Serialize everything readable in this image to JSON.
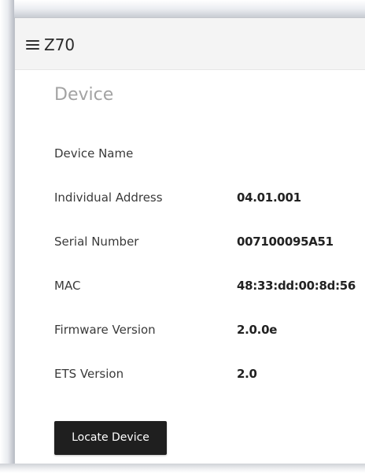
{
  "header": {
    "menu_icon": "hamburger-menu-icon",
    "title": "Z70"
  },
  "section": {
    "title": "Device"
  },
  "device_info": {
    "rows": [
      {
        "label": "Device Name",
        "value": ""
      },
      {
        "label": "Individual Address",
        "value": "04.01.001"
      },
      {
        "label": "Serial Number",
        "value": "007100095A51"
      },
      {
        "label": "MAC",
        "value": "48:33:dd:00:8d:56"
      },
      {
        "label": "Firmware Version",
        "value": "2.0.0e"
      },
      {
        "label": "ETS Version",
        "value": "2.0"
      }
    ]
  },
  "actions": {
    "locate_label": "Locate Device"
  },
  "colors": {
    "header_bg": "#f4f4f4",
    "section_title": "#a3a3a3",
    "button_bg": "#1f1f1f",
    "button_text": "#ffffff"
  }
}
